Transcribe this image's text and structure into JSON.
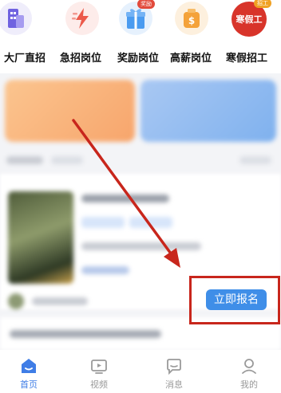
{
  "categories": [
    {
      "label": "大厂直招",
      "icon": "building-icon",
      "color": "#7b6ee8"
    },
    {
      "label": "急招岗位",
      "icon": "lightning-icon",
      "color": "#ec5a4b"
    },
    {
      "label": "奖励岗位",
      "icon": "gift-icon",
      "color": "#4a9bf0",
      "badge": "奖励"
    },
    {
      "label": "高薪岗位",
      "icon": "money-bag-icon",
      "color": "#f4a23a"
    },
    {
      "label": "寒假招工",
      "icon": "winter-job-icon",
      "color": "#d8342a",
      "badge": "招工",
      "icon_text": "寒假工"
    }
  ],
  "job_card": {
    "apply_label": "立即报名"
  },
  "tabbar": [
    {
      "label": "首页",
      "icon": "home-icon",
      "active": true
    },
    {
      "label": "视频",
      "icon": "video-icon",
      "active": false
    },
    {
      "label": "消息",
      "icon": "message-icon",
      "active": false
    },
    {
      "label": "我的",
      "icon": "profile-icon",
      "active": false
    }
  ],
  "colors": {
    "accent": "#3f7de6",
    "apply_button": "#3f8ee8",
    "annotation": "#c8261c"
  }
}
